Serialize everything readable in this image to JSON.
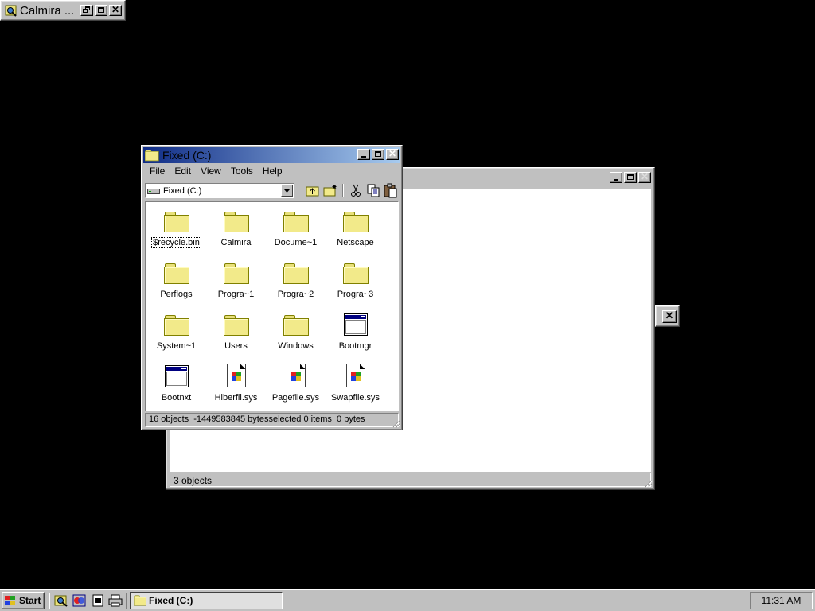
{
  "calmira_bar": {
    "title": "Calmira ..."
  },
  "back_window": {
    "status": "3 objects"
  },
  "drive_window": {
    "title": "Fixed (C:)",
    "menu": [
      "File",
      "Edit",
      "View",
      "Tools",
      "Help"
    ],
    "drive_select": "Fixed (C:)",
    "items": [
      {
        "label": "$recycle.bin",
        "icon": "folder"
      },
      {
        "label": "Calmira",
        "icon": "folder"
      },
      {
        "label": "Docume~1",
        "icon": "folder"
      },
      {
        "label": "Netscape",
        "icon": "folder"
      },
      {
        "label": "Perflogs",
        "icon": "folder"
      },
      {
        "label": "Progra~1",
        "icon": "folder"
      },
      {
        "label": "Progra~2",
        "icon": "folder"
      },
      {
        "label": "Progra~3",
        "icon": "folder"
      },
      {
        "label": "System~1",
        "icon": "folder"
      },
      {
        "label": "Users",
        "icon": "folder"
      },
      {
        "label": "Windows",
        "icon": "folder"
      },
      {
        "label": "Bootmgr",
        "icon": "application"
      },
      {
        "label": "Bootnxt",
        "icon": "application"
      },
      {
        "label": "Hiberfil.sys",
        "icon": "system-file"
      },
      {
        "label": "Pagefile.sys",
        "icon": "system-file"
      },
      {
        "label": "Swapfile.sys",
        "icon": "system-file"
      }
    ],
    "status_left": "16 objects  -1449583845 bytes",
    "status_right": "selected 0 items  0 bytes"
  },
  "taskbar": {
    "start_label": "Start",
    "task_label": "Fixed (C:)",
    "clock": "11:31 AM"
  }
}
